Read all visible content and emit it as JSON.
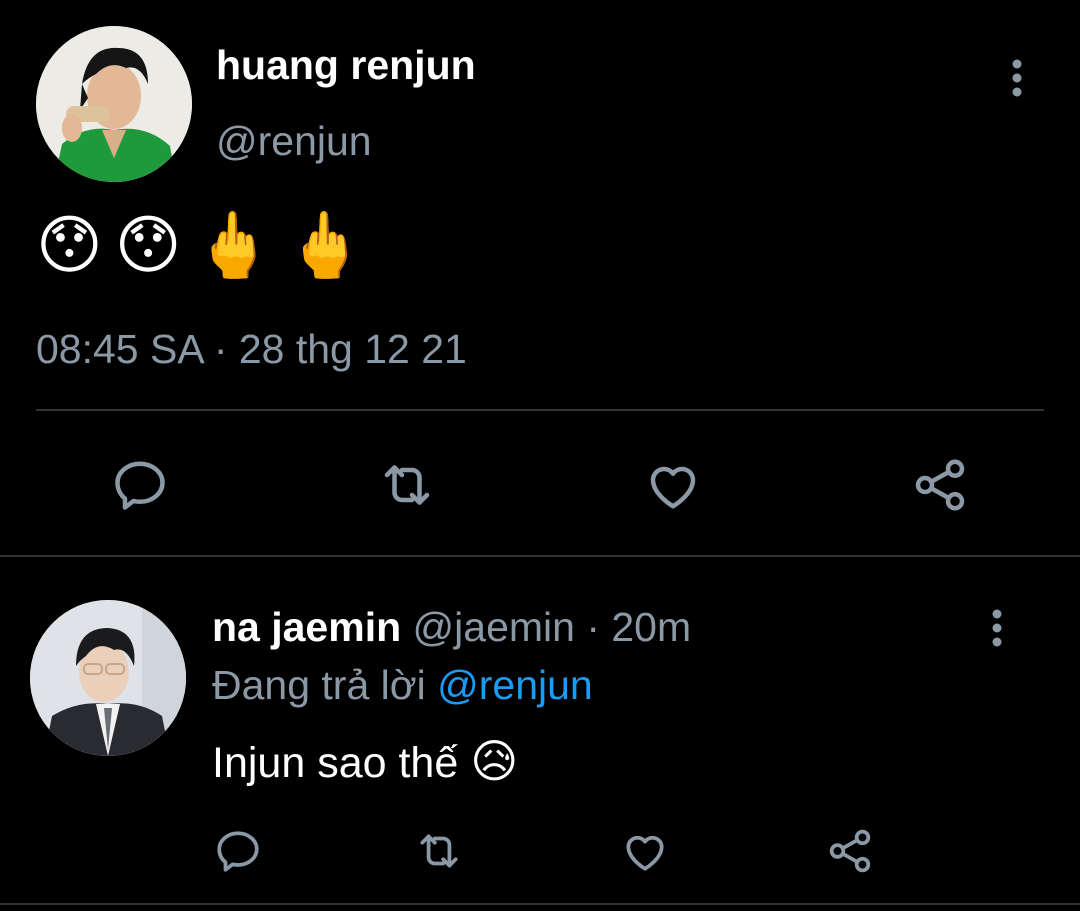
{
  "main_tweet": {
    "display_name": "huang renjun",
    "handle": "@renjun",
    "text_emojis": [
      "😯",
      "😯",
      "🖕",
      "🖕"
    ],
    "timestamp": "08:45 SA · 28 thg 12 21",
    "actions": [
      "reply-icon",
      "retweet-icon",
      "like-icon",
      "share-icon"
    ]
  },
  "reply": {
    "display_name": "na jaemin",
    "handle": "@jaemin",
    "separator": " · ",
    "time": "20m",
    "replying_prefix": "Đang trả lời ",
    "replying_to": "@renjun",
    "text": "Injun sao thế ",
    "text_emoji": "😥",
    "actions": [
      "reply-icon",
      "retweet-icon",
      "like-icon",
      "share-icon"
    ]
  },
  "colors": {
    "background": "#000000",
    "secondary_text": "#8b98a5",
    "mention": "#1d9bf0",
    "divider": "#2f3336"
  }
}
